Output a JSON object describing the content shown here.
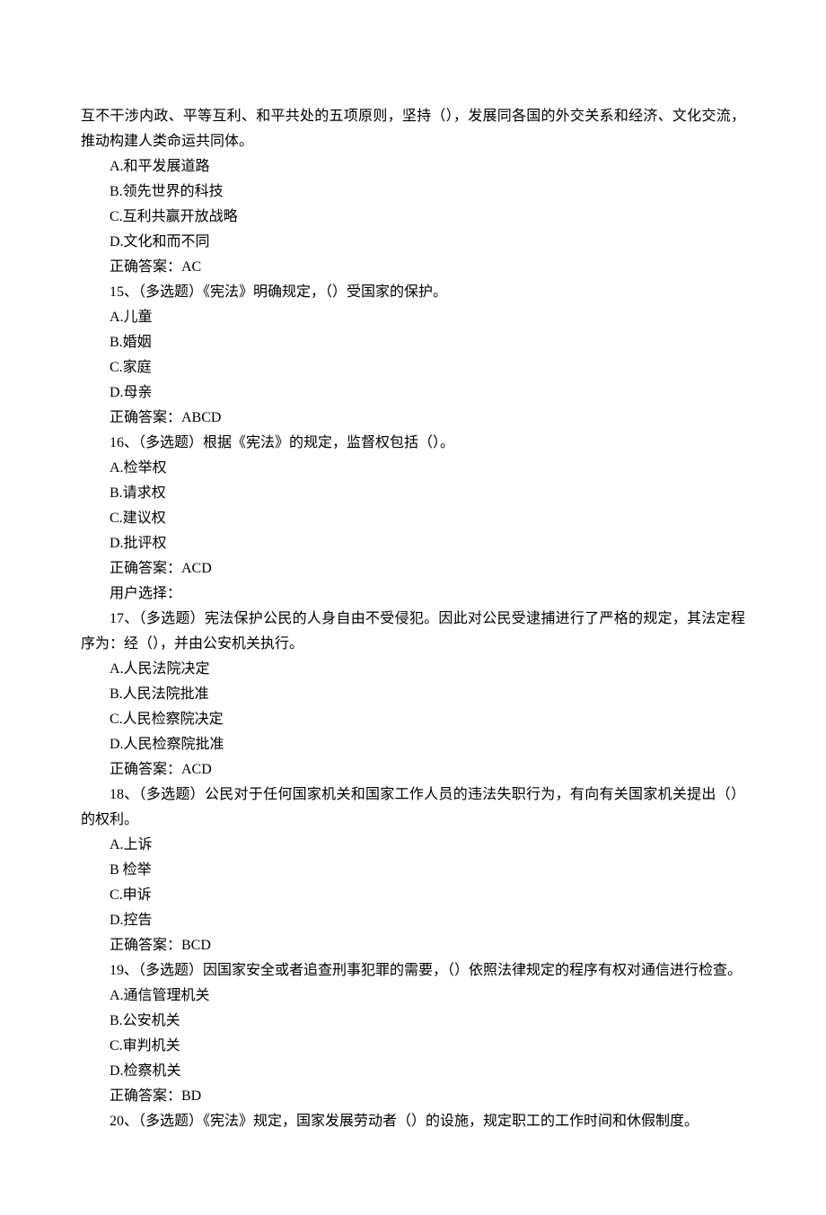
{
  "intro_lines": [
    "互不干涉内政、平等互利、和平共处的五项原则，坚持（），发展同各国的外交关系和经济、文化交流，推动构建人类命运共同体。"
  ],
  "intro_options": [
    "A.和平发展道路",
    "B.领先世界的科技",
    "C.互利共赢开放战略",
    "D.文化和而不同"
  ],
  "intro_answer": "正确答案：AC",
  "q15": {
    "stem": "15、（多选题）《宪法》明确规定，（）受国家的保护。",
    "options": [
      "A.儿童",
      "B.婚姻",
      "C.家庭",
      "D.母亲"
    ],
    "answer": "正确答案：ABCD"
  },
  "q16": {
    "stem": "16、（多选题）根据《宪法》的规定，监督权包括（）。",
    "options": [
      "A.检举权",
      "B.请求权",
      "C.建议权",
      "D.批评权"
    ],
    "answer": "正确答案：ACD",
    "user_choice": "用户选择："
  },
  "q17": {
    "stem": "17、（多选题）宪法保护公民的人身自由不受侵犯。因此对公民受逮捕进行了严格的规定，其法定程序为：经（），并由公安机关执行。",
    "options": [
      "A.人民法院决定",
      "B.人民法院批准",
      "C.人民检察院决定",
      "D.人民检察院批准"
    ],
    "answer": "正确答案：ACD"
  },
  "q18": {
    "stem": "18、（多选题）公民对于任何国家机关和国家工作人员的违法失职行为，有向有关国家机关提出（）的权利。",
    "options": [
      "A.上诉",
      "B 检举",
      "C.申诉",
      "D.控告"
    ],
    "answer": "正确答案：BCD"
  },
  "q19": {
    "stem": "19、（多选题）因国家安全或者追查刑事犯罪的需要，（）依照法律规定的程序有权对通信进行检查。",
    "options": [
      "A.通信管理机关",
      "B.公安机关",
      "C.审判机关",
      "D.检察机关"
    ],
    "answer": "正确答案：BD"
  },
  "q20": {
    "stem": "20、（多选题）《宪法》规定，国家发展劳动者（）的设施，规定职工的工作时间和休假制度。"
  }
}
